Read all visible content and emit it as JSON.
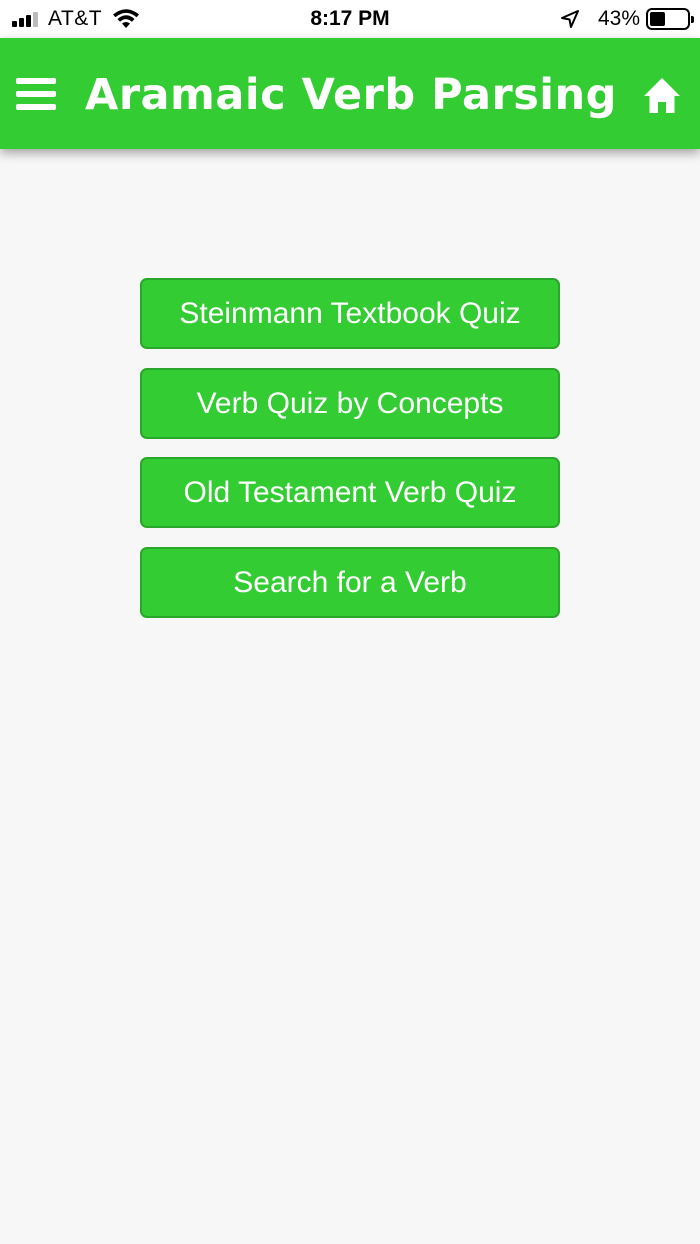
{
  "status_bar": {
    "carrier": "AT&T",
    "time": "8:17 PM",
    "battery": "43%",
    "battery_level": 0.43,
    "icons": [
      "signal-icon",
      "wifi-icon",
      "location-arrow-icon",
      "battery-icon"
    ]
  },
  "header": {
    "title": "Aramaic Verb Parsing",
    "menu_icon": "hamburger-menu-icon",
    "home_icon": "home-icon",
    "color": "#33cc33"
  },
  "menu": {
    "items": [
      {
        "label": "Steinmann Textbook Quiz"
      },
      {
        "label": "Verb Quiz by Concepts"
      },
      {
        "label": "Old Testament Verb Quiz"
      },
      {
        "label": "Search for a Verb"
      }
    ]
  }
}
